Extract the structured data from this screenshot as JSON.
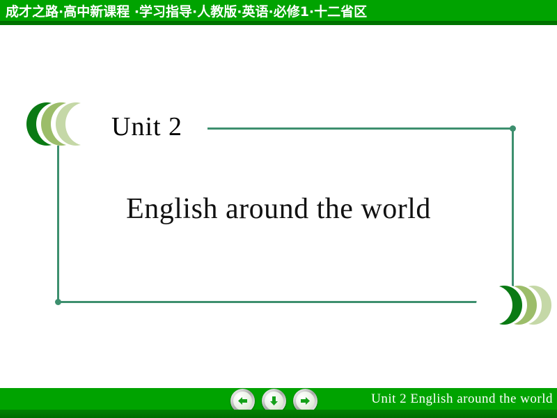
{
  "header": {
    "title": "成才之路·高中新课程 ·学习指导·人教版·英语·必修1·十二省区",
    "bar_color": "#00a300",
    "underbar_color": "#006d00",
    "text_color": "#ffffff"
  },
  "slide": {
    "unit_label": "Unit 2",
    "title": "English around the world",
    "frame_color": "#3d8f6e",
    "title_color": "#111111",
    "background": "#ffffff",
    "chevrons": {
      "left": {
        "direction": "left",
        "colors": [
          "#0a7a14",
          "#9cbd6a",
          "#c5d8a7"
        ]
      },
      "right": {
        "direction": "right",
        "colors": [
          "#c5d8a7",
          "#9cbd6a",
          "#0a7a14"
        ]
      }
    }
  },
  "footer": {
    "text": "Unit  2   English  around the world",
    "bar_color": "#00a300",
    "text_color": "#ffffff",
    "buttons": [
      {
        "name": "previous-slide-button",
        "icon": "arrow-left-icon",
        "label": "Previous"
      },
      {
        "name": "down-slide-button",
        "icon": "arrow-down-icon",
        "label": "Down"
      },
      {
        "name": "next-slide-button",
        "icon": "arrow-right-icon",
        "label": "Next"
      }
    ]
  }
}
